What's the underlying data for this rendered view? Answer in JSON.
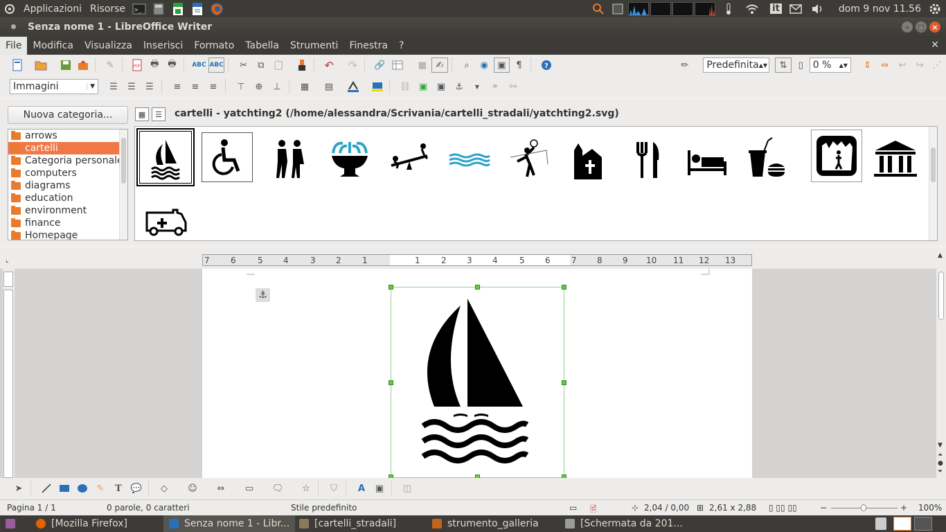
{
  "top_panel": {
    "applications": "Applicazioni",
    "places": "Risorse",
    "keyboard_layout": "it",
    "clock": "dom  9 nov 11.56"
  },
  "window": {
    "title": "Senza nome 1 - LibreOffice Writer"
  },
  "menu": [
    "File",
    "Modifica",
    "Visualizza",
    "Inserisci",
    "Formato",
    "Tabella",
    "Strumenti",
    "Finestra",
    "?"
  ],
  "toolbar1": {
    "style_value": "Predefinita",
    "percent_value": "0 %"
  },
  "toolbar2": {
    "frame_style_value": "Immagini"
  },
  "gallery": {
    "new_category_label": "Nuova categoria...",
    "title": "cartelli - yatchting2 (/home/alessandra/Scrivania/cartelli_stradali/yatchting2.svg)",
    "categories": [
      {
        "label": "arrows",
        "selected": false
      },
      {
        "label": "cartelli",
        "selected": true
      },
      {
        "label": "Categoria personale",
        "selected": false
      },
      {
        "label": "computers",
        "selected": false
      },
      {
        "label": "diagrams",
        "selected": false
      },
      {
        "label": "education",
        "selected": false
      },
      {
        "label": "environment",
        "selected": false
      },
      {
        "label": "finance",
        "selected": false
      },
      {
        "label": "Homepage",
        "selected": false
      }
    ],
    "items": [
      "sailing-icon",
      "wheelchair-icon",
      "hikers-icon",
      "fountain-icon",
      "seesaw-icon",
      "water-waves-icon",
      "volleyball-icon",
      "chapel-icon",
      "restaurant-icon",
      "hotel-bed-icon",
      "fastfood-icon",
      "cave-icon",
      "museum-icon",
      "ambulance-icon"
    ]
  },
  "ruler": {
    "ticks_left": [
      "7",
      "6",
      "5",
      "4",
      "3",
      "2",
      "1"
    ],
    "ticks_right": [
      "1",
      "2",
      "3",
      "4",
      "5",
      "6",
      "7",
      "8",
      "9",
      "10",
      "11",
      "12",
      "13"
    ]
  },
  "status": {
    "page": "Pagina 1 / 1",
    "words": "0 parole, 0 caratteri",
    "style": "Stile predefinito",
    "position": "2,04 / 0,00",
    "size": "2,61 x 2,88",
    "zoom": "100%"
  },
  "taskbar": [
    {
      "label": "[Mozilla Firefox]",
      "color": "#e66000",
      "active": false
    },
    {
      "label": "Senza nome 1 - Libr...",
      "color": "#2a6fb8",
      "active": true
    },
    {
      "label": "[cartelli_stradali]",
      "color": "#8a7a5a",
      "active": false
    },
    {
      "label": "strumento_galleria",
      "color": "#c2651a",
      "active": false
    },
    {
      "label": "[Schermata da 201...",
      "color": "#9b9b9b",
      "active": false
    }
  ]
}
